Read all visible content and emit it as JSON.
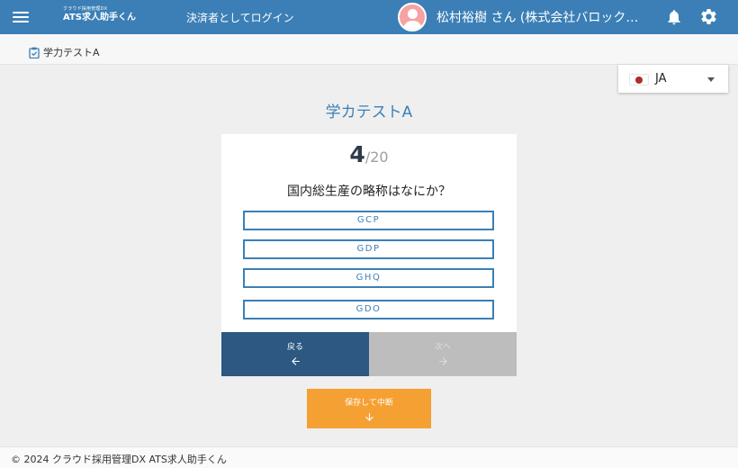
{
  "header": {
    "logo_sub": "クラウド採用管理DX",
    "logo_main": "ATS求人助手くん",
    "login_as": "決済者としてログイン",
    "user_name": "松村裕樹 さん (株式会社バロックワークス)"
  },
  "breadcrumb": {
    "item": "学力テストA"
  },
  "language": {
    "code": "JA"
  },
  "quiz": {
    "title": "学カテストA",
    "current": "4",
    "total": "/20",
    "question": "国内総生産の略称はなにか？",
    "options": [
      "GCP",
      "GDP",
      "GHQ",
      "GDO"
    ]
  },
  "nav": {
    "back_label": "戻る",
    "next_label": "次へ",
    "save_label": "保存して中断"
  },
  "footer": {
    "copyright": "© 2024 クラウド採用管理DX ATS求人助手くん"
  },
  "colors": {
    "header": "#3b7fb6",
    "back_button": "#2c5882",
    "next_button_disabled": "#bdbdbd",
    "save_button": "#f5a033",
    "option_border": "#3b7fb6"
  },
  "icons": [
    "menu-icon",
    "bell-icon",
    "gear-icon",
    "clipboard-icon",
    "arrow-left-icon",
    "arrow-right-icon",
    "arrow-down-icon",
    "user-avatar-icon",
    "japan-flag-icon",
    "caret-down-icon"
  ]
}
